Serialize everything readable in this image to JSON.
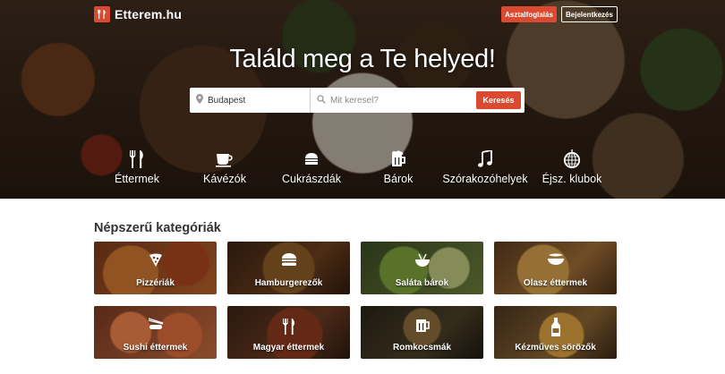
{
  "brand": {
    "name": "Etterem.hu",
    "accent": "#d94a30"
  },
  "header": {
    "reserve_label": "Asztalfoglalás",
    "login_label": "Bejelentkezés"
  },
  "hero": {
    "headline": "Találd meg a Te helyed!",
    "search": {
      "location_value": "Budapest",
      "query_placeholder": "Mit keresel?",
      "button_label": "Keresés"
    },
    "categories": [
      {
        "label": "Éttermek",
        "icon": "fork-knife-icon"
      },
      {
        "label": "Kávézók",
        "icon": "coffee-cup-icon"
      },
      {
        "label": "Cukrászdák",
        "icon": "cake-icon"
      },
      {
        "label": "Bárok",
        "icon": "beer-mug-icon"
      },
      {
        "label": "Szórakozóhelyek",
        "icon": "music-note-icon"
      },
      {
        "label": "Éjsz. klubok",
        "icon": "disco-ball-icon"
      }
    ]
  },
  "popular": {
    "title": "Népszerű kategóriák",
    "tiles": [
      {
        "label": "Pizzériák",
        "icon": "pizza-icon"
      },
      {
        "label": "Hamburgerezők",
        "icon": "burger-icon"
      },
      {
        "label": "Saláta bárok",
        "icon": "salad-bowl-icon"
      },
      {
        "label": "Olasz éttermek",
        "icon": "pasta-icon"
      },
      {
        "label": "Sushi éttermek",
        "icon": "sushi-icon"
      },
      {
        "label": "Magyar éttermek",
        "icon": "fork-knife-icon"
      },
      {
        "label": "Romkocsmák",
        "icon": "beer-mug-icon"
      },
      {
        "label": "Kézműves sörözők",
        "icon": "beer-bottle-icon"
      }
    ]
  }
}
